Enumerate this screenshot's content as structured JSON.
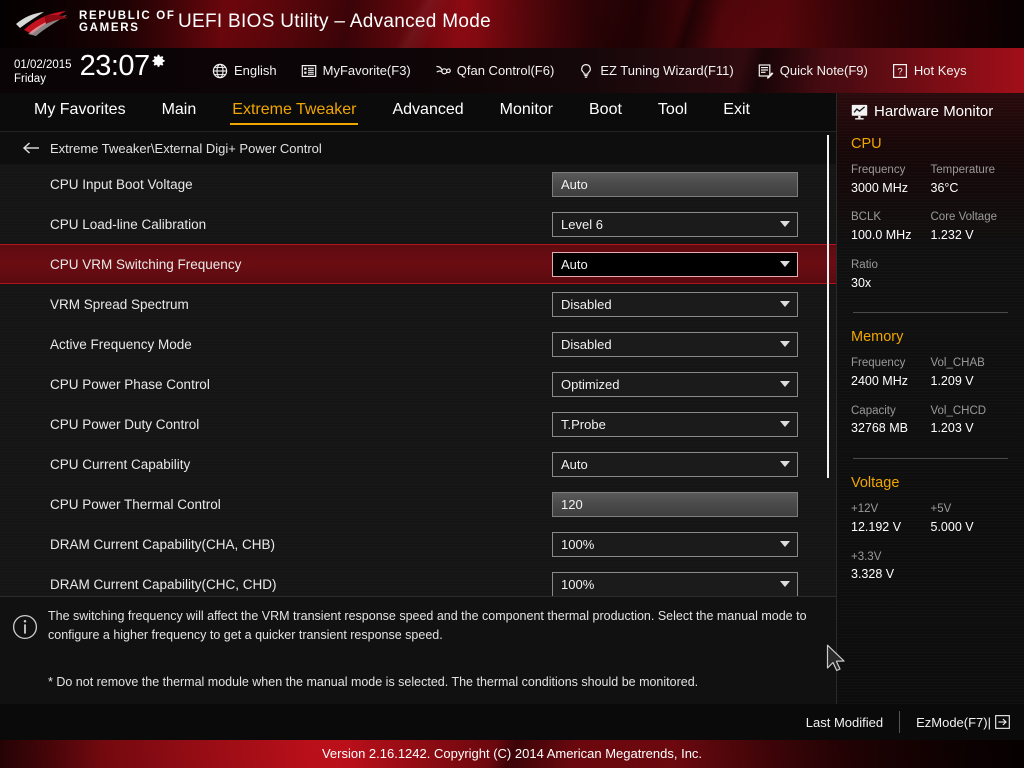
{
  "header": {
    "logo_line1": "REPUBLIC OF",
    "logo_line2": "GAMERS",
    "logo_icon": "rog-eye-logo",
    "title": "UEFI BIOS Utility – Advanced Mode"
  },
  "toolbar": {
    "date": "01/02/2015",
    "day": "Friday",
    "time": "23:07",
    "settings_icon": "gear-icon",
    "items": [
      {
        "label": "English",
        "icon": "globe-icon"
      },
      {
        "label": "MyFavorite(F3)",
        "icon": "list-document-icon"
      },
      {
        "label": "Qfan Control(F6)",
        "icon": "fan-icon"
      },
      {
        "label": "EZ Tuning Wizard(F11)",
        "icon": "lightbulb-icon"
      },
      {
        "label": "Quick Note(F9)",
        "icon": "note-pencil-icon"
      },
      {
        "label": "Hot Keys",
        "icon": "question-box-icon"
      }
    ]
  },
  "nav": {
    "tabs": [
      {
        "label": "My Favorites",
        "active": false
      },
      {
        "label": "Main",
        "active": false
      },
      {
        "label": "Extreme Tweaker",
        "active": true
      },
      {
        "label": "Advanced",
        "active": false
      },
      {
        "label": "Monitor",
        "active": false
      },
      {
        "label": "Boot",
        "active": false
      },
      {
        "label": "Tool",
        "active": false
      },
      {
        "label": "Exit",
        "active": false
      }
    ],
    "active_color": "#f0a500"
  },
  "breadcrumb": {
    "back_icon": "arrow-left-icon",
    "path": "Extreme Tweaker\\External Digi+ Power Control"
  },
  "settings": {
    "rows": [
      {
        "label": "CPU Input Boot Voltage",
        "value": "Auto",
        "control": "field",
        "selected": false
      },
      {
        "label": "CPU Load-line Calibration",
        "value": "Level 6",
        "control": "dropdown",
        "selected": false
      },
      {
        "label": "CPU VRM Switching Frequency",
        "value": "Auto",
        "control": "dropdown",
        "selected": true
      },
      {
        "label": "VRM Spread Spectrum",
        "value": "Disabled",
        "control": "dropdown",
        "selected": false
      },
      {
        "label": "Active Frequency Mode",
        "value": "Disabled",
        "control": "dropdown",
        "selected": false
      },
      {
        "label": "CPU Power Phase Control",
        "value": "Optimized",
        "control": "dropdown",
        "selected": false
      },
      {
        "label": "CPU Power Duty Control",
        "value": "T.Probe",
        "control": "dropdown",
        "selected": false
      },
      {
        "label": "CPU Current Capability",
        "value": "Auto",
        "control": "dropdown",
        "selected": false
      },
      {
        "label": "CPU Power Thermal Control",
        "value": "120",
        "control": "field",
        "selected": false
      },
      {
        "label": "DRAM Current Capability(CHA, CHB)",
        "value": "100%",
        "control": "dropdown",
        "selected": false
      },
      {
        "label": "DRAM Current Capability(CHC, CHD)",
        "value": "100%",
        "control": "dropdown",
        "selected": false
      }
    ],
    "selected_row_color": "#b3141d"
  },
  "help": {
    "info_icon": "info-circle-icon",
    "text": "The switching frequency will affect the VRM transient response speed and the component thermal production. Select the manual mode to configure a higher frequency to get a quicker transient response speed.",
    "note": "* Do not remove the thermal module when the manual mode is selected. The thermal conditions should be monitored."
  },
  "hardware_monitor": {
    "icon": "monitor-chart-icon",
    "title": "Hardware Monitor",
    "sections": [
      {
        "heading": "CPU",
        "pairs": [
          {
            "k1": "Frequency",
            "v1": "3000 MHz",
            "k2": "Temperature",
            "v2": "36°C"
          },
          {
            "k1": "BCLK",
            "v1": "100.0 MHz",
            "k2": "Core Voltage",
            "v2": "1.232 V"
          },
          {
            "k1": "Ratio",
            "v1": "30x",
            "k2": "",
            "v2": ""
          }
        ]
      },
      {
        "heading": "Memory",
        "pairs": [
          {
            "k1": "Frequency",
            "v1": "2400 MHz",
            "k2": "Vol_CHAB",
            "v2": "1.209 V"
          },
          {
            "k1": "Capacity",
            "v1": "32768 MB",
            "k2": "Vol_CHCD",
            "v2": "1.203 V"
          }
        ]
      },
      {
        "heading": "Voltage",
        "pairs": [
          {
            "k1": "+12V",
            "v1": "12.192 V",
            "k2": "+5V",
            "v2": "5.000 V"
          },
          {
            "k1": "+3.3V",
            "v1": "3.328 V",
            "k2": "",
            "v2": ""
          }
        ]
      }
    ],
    "heading_color": "#f0a500"
  },
  "footer": {
    "last_modified": "Last Modified",
    "ez_mode": "EzMode(F7)|",
    "ez_mode_icon": "arrow-right-box-icon",
    "version": "Version 2.16.1242. Copyright (C) 2014 American Megatrends, Inc."
  },
  "cursor": {
    "icon": "mouse-pointer-arrow"
  }
}
